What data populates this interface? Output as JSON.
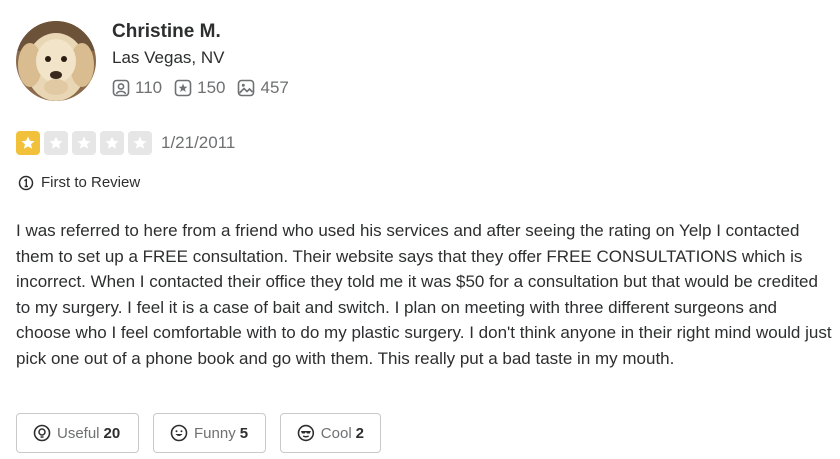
{
  "user": {
    "name": "Christine M.",
    "location": "Las Vegas, NV",
    "friends_count": "110",
    "reviews_count": "150",
    "photos_count": "457"
  },
  "review": {
    "rating": 1,
    "max_rating": 5,
    "date": "1/21/2011",
    "badge_label": "First to Review",
    "text": "I was referred to here from a friend who used his services and after seeing the rating on Yelp I contacted them to set up a FREE consultation.  Their website says that they offer FREE CONSULTATIONS which is incorrect.  When I contacted their office they told me it was $50 for a consultation but that would be credited to my surgery.  I feel it is a case of bait and switch.  I plan on meeting with three different surgeons and choose who I feel comfortable with to do my plastic surgery.  I don't think anyone in their right mind would just pick one out of a phone book and go with them.  This really put a bad taste in my mouth."
  },
  "reactions": {
    "useful_label": "Useful",
    "useful_count": "20",
    "funny_label": "Funny",
    "funny_count": "5",
    "cool_label": "Cool",
    "cool_count": "2"
  },
  "colors": {
    "star_filled": "#f2c13c",
    "star_empty": "#e6e6e6",
    "text_primary": "#2d2e2f",
    "text_secondary": "#6e7072",
    "border": "#c8c9ca"
  },
  "icons": {
    "avatar": "dog-photo",
    "friends": "friends-icon",
    "reviews": "star-review-icon",
    "photos": "photo-icon",
    "badge": "first-review-icon",
    "useful": "lightbulb-icon",
    "funny": "smile-icon",
    "cool": "sunglasses-icon"
  }
}
